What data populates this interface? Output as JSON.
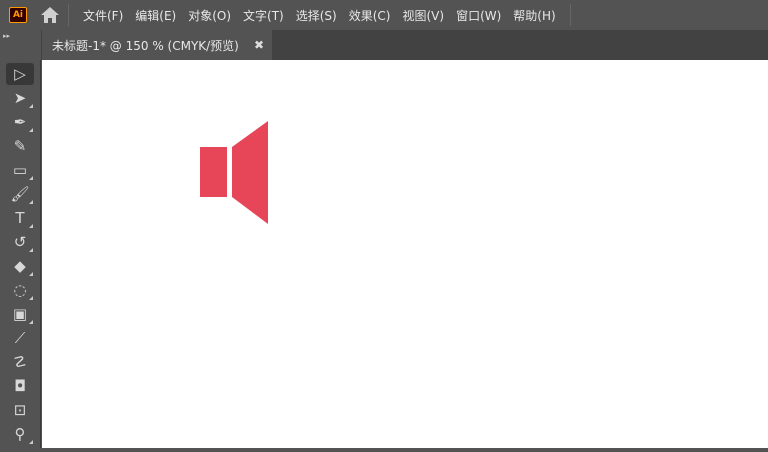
{
  "app": {
    "logo": "Ai"
  },
  "menu": [
    "文件(F)",
    "编辑(E)",
    "对象(O)",
    "文字(T)",
    "选择(S)",
    "效果(C)",
    "视图(V)",
    "窗口(W)",
    "帮助(H)"
  ],
  "document_tab": {
    "title": "未标题-1* @ 150 % (CMYK/预览)",
    "close": "✖"
  },
  "tools": [
    {
      "name": "selection-tool",
      "glyph": "▷"
    },
    {
      "name": "direct-selection-tool",
      "glyph": "➤"
    },
    {
      "name": "pen-tool",
      "glyph": "✒"
    },
    {
      "name": "curvature-tool",
      "glyph": "✎"
    },
    {
      "name": "rectangle-tool",
      "glyph": "▭"
    },
    {
      "name": "paintbrush-tool",
      "glyph": "🖌"
    },
    {
      "name": "type-tool",
      "glyph": "T"
    },
    {
      "name": "rotate-tool",
      "glyph": "↺"
    },
    {
      "name": "eraser-tool",
      "glyph": "◆"
    },
    {
      "name": "lasso-tool",
      "glyph": "◌"
    },
    {
      "name": "gradient-tool",
      "glyph": "▣"
    },
    {
      "name": "eyedropper-tool",
      "glyph": "⟋"
    },
    {
      "name": "puppet-warp-tool",
      "glyph": "☡"
    },
    {
      "name": "shape-builder-tool",
      "glyph": "◘"
    },
    {
      "name": "artboard-tool",
      "glyph": "⊡"
    },
    {
      "name": "zoom-tool",
      "glyph": "⚲"
    }
  ],
  "artwork": {
    "speaker_color": "#E64657"
  }
}
